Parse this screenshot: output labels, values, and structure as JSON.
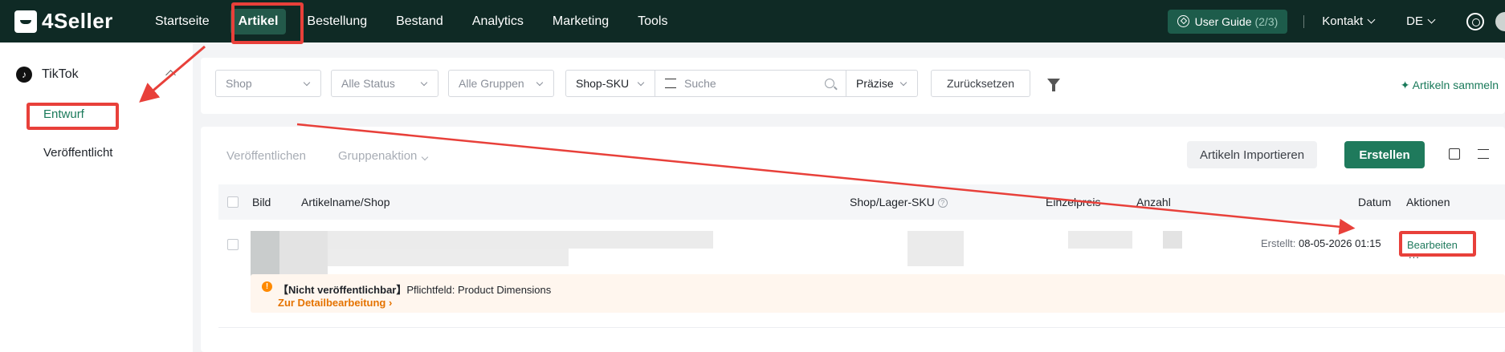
{
  "brand": {
    "name": "4Seller"
  },
  "nav": {
    "items": [
      "Startseite",
      "Artikel",
      "Bestellung",
      "Bestand",
      "Analytics",
      "Marketing",
      "Tools"
    ],
    "active": "Artikel"
  },
  "topright": {
    "guide_label": "User Guide",
    "guide_count": "(2/3)",
    "contact": "Kontakt",
    "language": "DE"
  },
  "sidebar": {
    "platform": "TikTok",
    "items": [
      {
        "label": "Entwurf",
        "active": true
      },
      {
        "label": "Veröffentlicht",
        "active": false
      }
    ]
  },
  "filters": {
    "shop": "Shop",
    "status": "Alle Status",
    "groups": "Alle Gruppen",
    "sku_type": "Shop-SKU",
    "search_placeholder": "Suche",
    "match": "Präzise",
    "reset": "Zurücksetzen",
    "collect": "Artikeln sammeln"
  },
  "toolbar": {
    "publish": "Veröffentlichen",
    "group_action": "Gruppenaktion",
    "import": "Artikeln Importieren",
    "create": "Erstellen"
  },
  "table": {
    "columns": [
      "Bild",
      "Artikelname/Shop",
      "Shop/Lager-SKU",
      "Einzelpreis",
      "Anzahl",
      "Datum",
      "Aktionen"
    ],
    "rows": [
      {
        "date_label": "Erstellt:",
        "date": "08-05-2026 01:15",
        "action": "Bearbeiten",
        "more": "...",
        "warning_tag": "【Nicht veröffentlichbar】",
        "warning_text": "Pflichtfeld: Product Dimensions",
        "warning_link": "Zur Detailbearbeitung"
      }
    ]
  },
  "colors": {
    "topbar": "#0f2a25",
    "accent": "#1f7a5c",
    "annotation": "#e8403a",
    "warning": "#ff8a00"
  }
}
